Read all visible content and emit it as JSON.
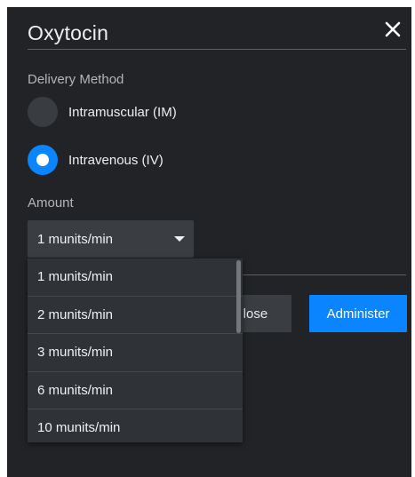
{
  "dialog": {
    "title": "Oxytocin",
    "close_icon": "close-icon"
  },
  "delivery": {
    "label": "Delivery Method",
    "options": [
      {
        "label": "Intramuscular (IM)",
        "selected": false
      },
      {
        "label": "Intravenous (IV)",
        "selected": true
      }
    ]
  },
  "amount": {
    "label": "Amount",
    "selected": "1 munits/min",
    "caret_icon": "caret-down-icon",
    "options": [
      "1 munits/min",
      "2 munits/min",
      "3 munits/min",
      "6 munits/min",
      "10 munits/min"
    ]
  },
  "footer": {
    "close_label": "Close",
    "administer_label": "Administer"
  },
  "colors": {
    "background": "#212326",
    "accent": "#0b84ff",
    "control": "#3a3d41",
    "text": "#eceef0",
    "muted_text": "#b2b5b9"
  }
}
